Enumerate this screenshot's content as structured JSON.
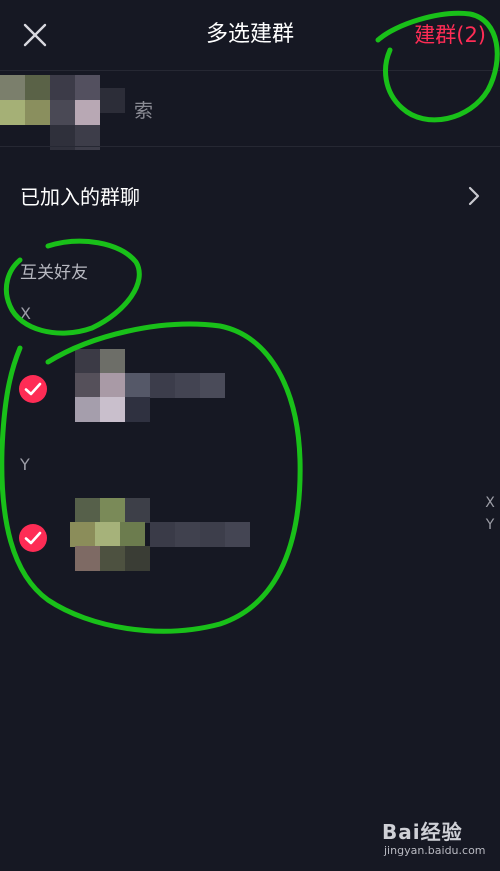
{
  "header": {
    "title": "多选建群",
    "create_button": "建群(2)",
    "close_icon": "close-icon"
  },
  "search": {
    "placeholder": "索"
  },
  "joined_groups": {
    "label": "已加入的群聊",
    "chevron_icon": "chevron-right-icon"
  },
  "mutual_friends": {
    "section_title": "互关好友",
    "groups": [
      {
        "letter": "X",
        "friends": [
          {
            "name": "",
            "checked": true
          }
        ]
      },
      {
        "letter": "Y",
        "friends": [
          {
            "name": "",
            "checked": true
          }
        ]
      }
    ]
  },
  "index_bar": [
    "X",
    "Y"
  ],
  "watermark": {
    "main": "Bai经验",
    "sub": "jingyan.baidu.com"
  },
  "colors": {
    "background": "#161823",
    "accent": "#fe2c55",
    "annotation": "#19c019"
  }
}
